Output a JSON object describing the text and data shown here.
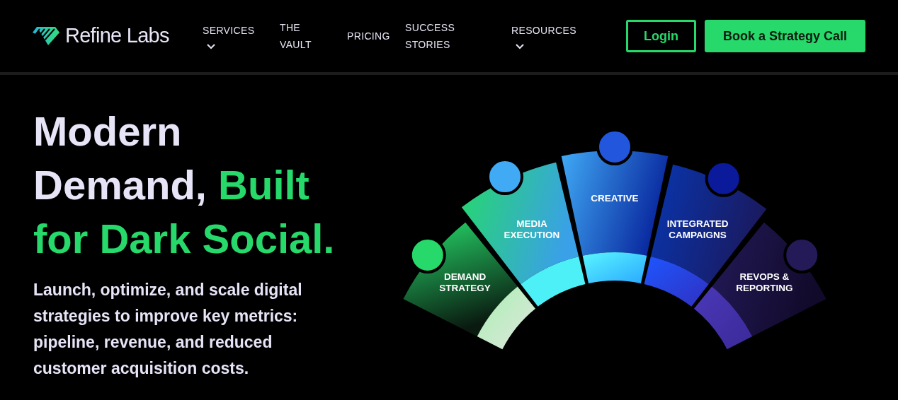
{
  "logo": {
    "text": "Refine Labs"
  },
  "nav": [
    {
      "label_lines": [
        "SERVICES"
      ],
      "dropdown": true
    },
    {
      "label_lines": [
        "THE",
        "VAULT"
      ],
      "dropdown": false
    },
    {
      "label_lines": [
        "PRICING"
      ],
      "dropdown": false
    },
    {
      "label_lines": [
        "SUCCESS",
        "STORIES"
      ],
      "dropdown": false
    },
    {
      "label_lines": [
        "RESOURCES"
      ],
      "dropdown": true
    }
  ],
  "buttons": [
    {
      "label": "Login",
      "kind": "outline"
    },
    {
      "label": "Book a Strategy Call",
      "kind": "solid"
    }
  ],
  "hero": {
    "headline_lead": "Modern Demand,",
    "headline_accent": "Built for Dark Social.",
    "body": "Launch, optimize, and scale digital strategies to improve key metrics: pipeline, revenue, and reduced customer acquisition costs."
  },
  "segments": [
    {
      "label_lines": [
        "DEMAND",
        "STRATEGY"
      ],
      "color": "#26d96a"
    },
    {
      "label_lines": [
        "MEDIA",
        "EXECUTION"
      ],
      "color": "#40aaf5"
    },
    {
      "label_lines": [
        "CREATIVE"
      ],
      "color": "#2256dc"
    },
    {
      "label_lines": [
        "INTEGRATED",
        "CAMPAIGNS"
      ],
      "color": "#0a1a9a"
    },
    {
      "label_lines": [
        "REVOPS &",
        "REPORTING"
      ],
      "color": "#241a58"
    }
  ]
}
